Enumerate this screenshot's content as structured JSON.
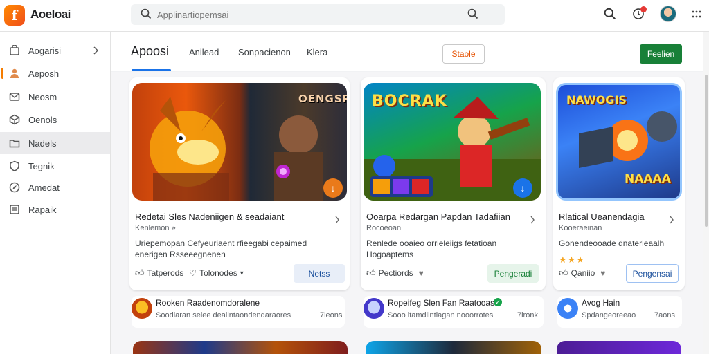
{
  "app": {
    "name": "Aoeloai"
  },
  "search": {
    "placeholder": "Applinartiopemsai"
  },
  "sidebar": {
    "items": [
      {
        "label": "Aogarisi"
      },
      {
        "label": "Aeposh"
      },
      {
        "label": "Neosm"
      },
      {
        "label": "Oenols"
      },
      {
        "label": "Nadels"
      },
      {
        "label": "Tegnik"
      },
      {
        "label": "Amedat"
      },
      {
        "label": "Rapaik"
      }
    ]
  },
  "tabs": [
    {
      "label": "Apoosi"
    },
    {
      "label": "Anilead"
    },
    {
      "label": "Sonpacienon"
    },
    {
      "label": "Klera"
    }
  ],
  "actions": {
    "outline_label": "Staole",
    "primary_label": "Feelien"
  },
  "cards": [
    {
      "title": "Redetai Sles Nadeniigen & seadaiant",
      "subtitle": "Kenlemon »",
      "desc1": "Uriepemopan Cefyeuriaent rfieegabi cepaimed",
      "desc2": "enerigen Rsseeegnenen",
      "likes": "Tatperods",
      "saves": "Tolonodes",
      "button": "Netss",
      "art_title": "OENGSR"
    },
    {
      "title": "Ooarpa Redargan Papdan Tadafiian",
      "subtitle": "Rocoeoan",
      "desc1": "Renlede ooaieo orrieleiigs fetatioan",
      "desc2": "Hogoaptems",
      "likes": "Pectiords",
      "button": "Pengeradi",
      "art_title": "BOCRAK"
    },
    {
      "title": "Rlatical Ueanendagia",
      "subtitle": "Kooeraeinan",
      "desc1": "Gonendeooade dnaterleaalh",
      "stars": "★★★",
      "likes": "Qaniio",
      "button": "Pengensai",
      "art_title": "NAWOGIS",
      "art_banner": "NAAAA"
    }
  ],
  "info_rows": [
    {
      "title": "Rooken Raadenomdoralene",
      "sub": "Soodiaran selee dealintaondendaraores",
      "count": "7leons"
    },
    {
      "title": "Ropeifeg Slen Fan Raatooas",
      "sub": "Sooo ltamdiintiagan nooorrotes",
      "count": "7lronk"
    },
    {
      "title": "Avog Hain",
      "sub": "Spdangeoreeao",
      "count": "7aons"
    }
  ],
  "colors": {
    "accent": "#1a73e8",
    "primary_button": "#188038",
    "brand_orange": "#f57c00"
  }
}
